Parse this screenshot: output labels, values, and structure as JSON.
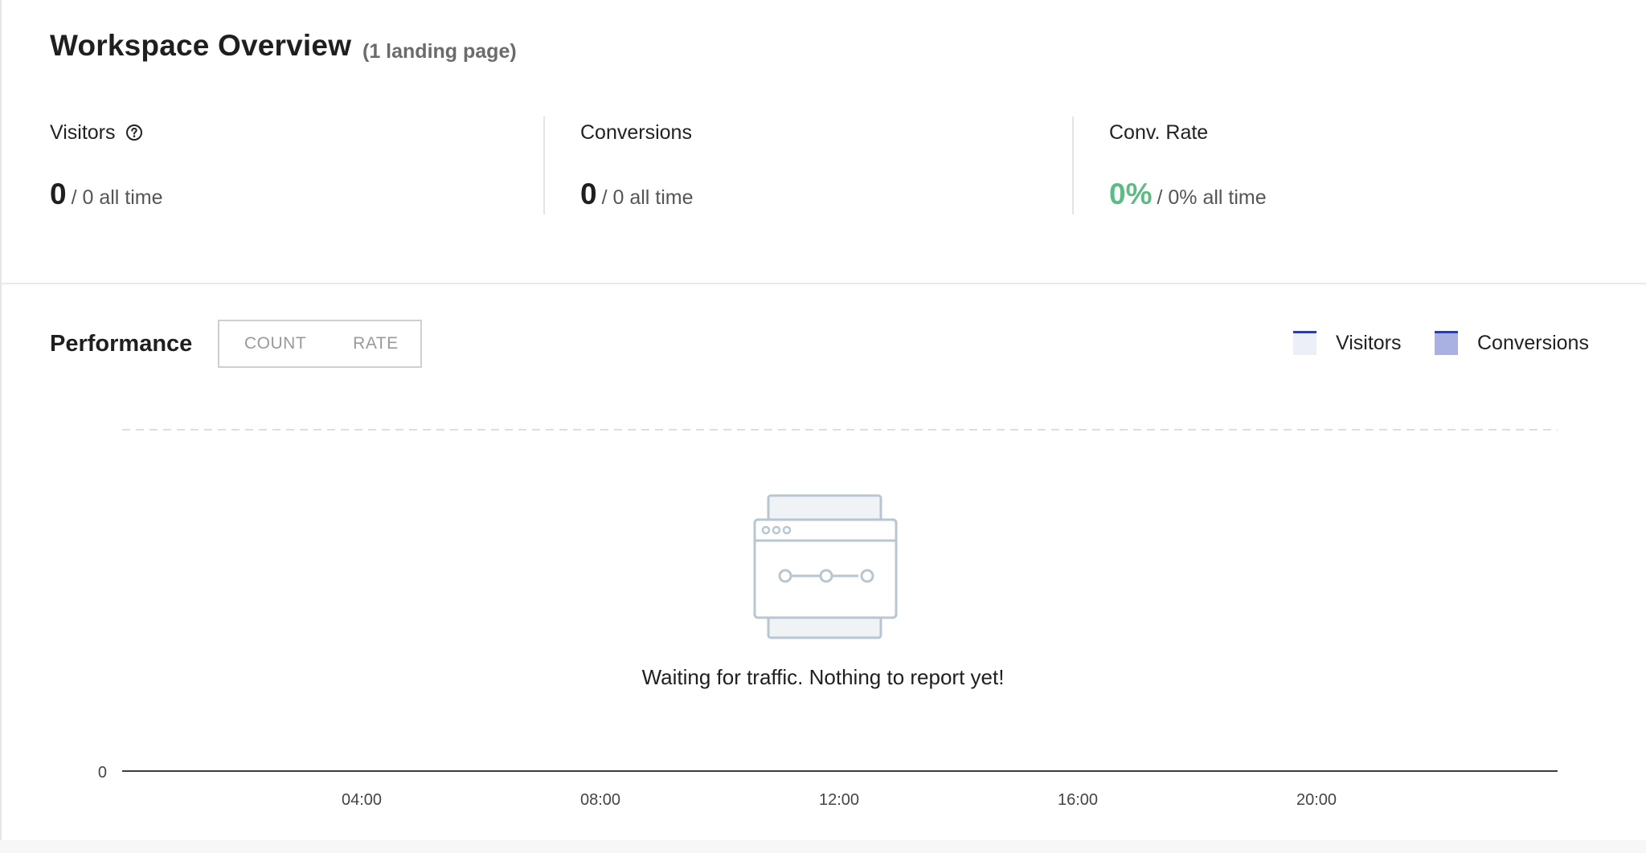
{
  "header": {
    "title": "Workspace Overview",
    "subtitle": "(1 landing page)"
  },
  "stats": [
    {
      "label": "Visitors",
      "value": "0",
      "all_time": "/ 0 all time",
      "has_help": true
    },
    {
      "label": "Conversions",
      "value": "0",
      "all_time": "/ 0 all time"
    },
    {
      "label": "Conv. Rate",
      "value": "0%",
      "all_time": "/ 0% all time",
      "value_color": "#5dbb85"
    }
  ],
  "performance": {
    "title": "Performance",
    "toggle": {
      "count_label": "COUNT",
      "rate_label": "RATE"
    },
    "legend": [
      {
        "name": "Visitors",
        "fill": "#eceef8",
        "edge": "#2b3ea3"
      },
      {
        "name": "Conversions",
        "fill": "#a9b1e3",
        "edge": "#2b3ea3"
      }
    ],
    "empty_message": "Waiting for traffic. Nothing to report yet!"
  },
  "chart_data": {
    "type": "area",
    "x": [
      "04:00",
      "08:00",
      "12:00",
      "16:00",
      "20:00"
    ],
    "series": [
      {
        "name": "Visitors",
        "values": []
      },
      {
        "name": "Conversions",
        "values": []
      }
    ],
    "y_ticks": [
      "0"
    ],
    "grid": true,
    "legend_position": "top-right"
  }
}
